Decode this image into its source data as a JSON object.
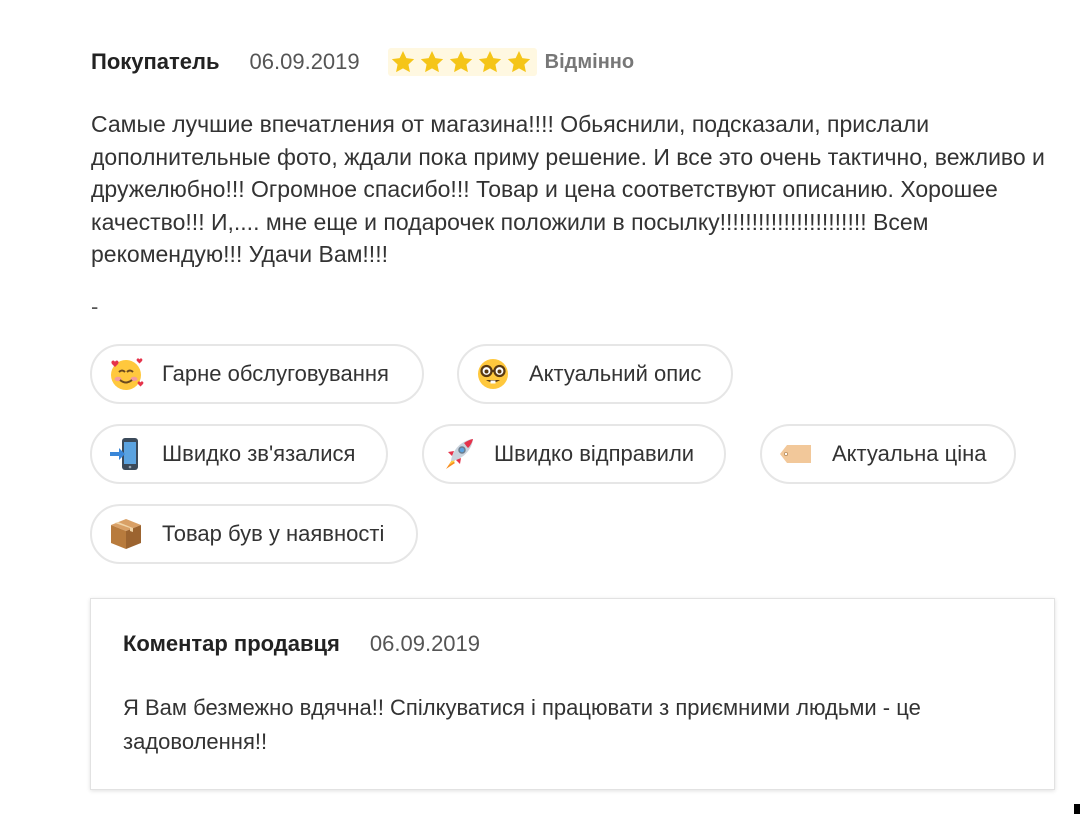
{
  "review": {
    "author": "Покупатель",
    "date": "06.09.2019",
    "stars": 5,
    "rating_label": "Відмінно",
    "text": "Самые лучшие впечатления от магазина!!!! Обьяснили, подсказали, прислали дополнительные фото, ждали пока приму решение. И все это очень тактично, вежливо и дружелюбно!!! Огромное спасибо!!! Товар и цена соответствуют описанию. Хорошее качество!!! И,.... мне еще и подарочек положили в посылку!!!!!!!!!!!!!!!!!!!!!!! Всем рекомендую!!! Удачи Вам!!!!",
    "separator": "-",
    "star_color": "#f5c518"
  },
  "tags": [
    {
      "label": "Гарне обслуговування",
      "icon": "smiling-face-with-hearts-icon"
    },
    {
      "label": "Актуальний опис",
      "icon": "nerd-face-icon"
    },
    {
      "label": "Швидко зв'язалися",
      "icon": "mobile-phone-with-arrow-icon"
    },
    {
      "label": "Швидко відправили",
      "icon": "rocket-icon"
    },
    {
      "label": "Актуальна ціна",
      "icon": "price-tag-icon"
    },
    {
      "label": "Товар був у наявності",
      "icon": "package-icon"
    }
  ],
  "seller_comment": {
    "title": "Коментар продавця",
    "date": "06.09.2019",
    "text": "Я Вам безмежно вдячна!! Спілкуватися і працювати з приємними людьми - це задоволення!!"
  }
}
